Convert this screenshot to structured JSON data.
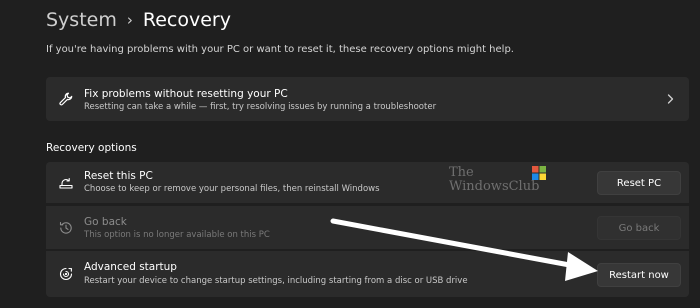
{
  "header": {
    "breadcrumb_parent": "System",
    "breadcrumb_separator": "›",
    "breadcrumb_current": "Recovery"
  },
  "description": "If you're having problems with your PC or want to reset it, these recovery options might help.",
  "fix_card": {
    "title": "Fix problems without resetting your PC",
    "subtitle": "Resetting can take a while — first, try resolving issues by running a troubleshooter",
    "icon": "wrench-icon"
  },
  "recovery_options": {
    "heading": "Recovery options",
    "items": [
      {
        "title": "Reset this PC",
        "subtitle": "Choose to keep or remove your personal files, then reinstall Windows",
        "button": "Reset PC",
        "icon": "reset-pc-icon",
        "enabled": true
      },
      {
        "title": "Go back",
        "subtitle": "This option is no longer available on this PC",
        "button": "Go back",
        "icon": "history-icon",
        "enabled": false
      },
      {
        "title": "Advanced startup",
        "subtitle": "Restart your device to change startup settings, including starting from a disc or USB drive",
        "button": "Restart now",
        "icon": "advanced-startup-icon",
        "enabled": true
      }
    ]
  },
  "watermark": {
    "line1": "The",
    "line2": "WindowsClub"
  },
  "colors": {
    "background": "#1f1f1f",
    "card": "#2b2b2b",
    "button": "#373737",
    "text": "#ffffff",
    "muted_text": "#c9c9c9",
    "disabled_text": "#7a7a7a"
  }
}
